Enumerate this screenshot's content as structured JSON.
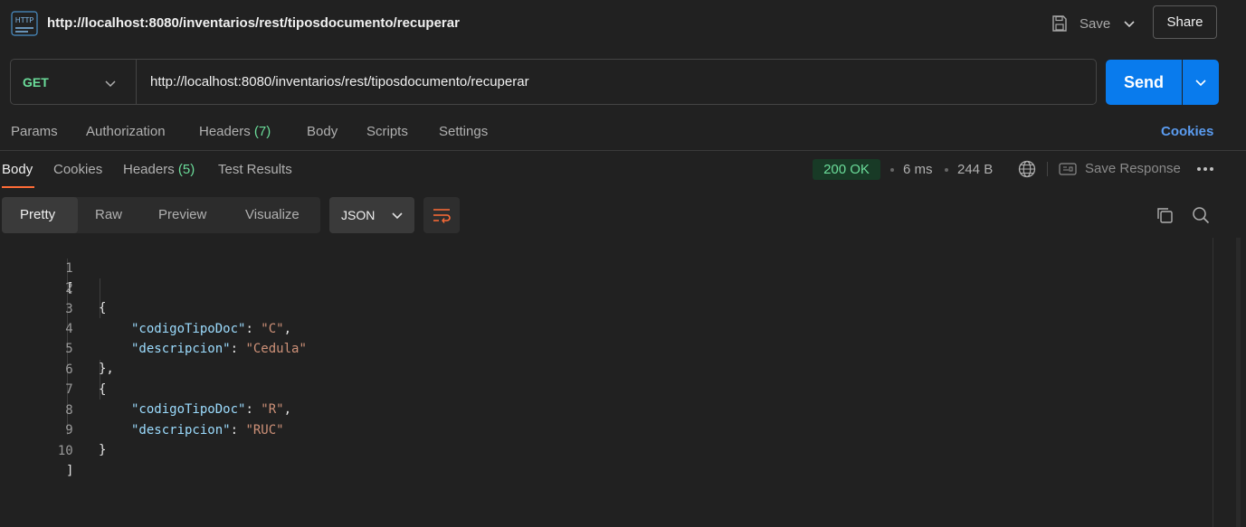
{
  "header": {
    "request_title": "http://localhost:8080/inventarios/rest/tiposdocumento/recuperar",
    "save_label": "Save",
    "share_label": "Share",
    "http_icon_text": "HTTP"
  },
  "url_bar": {
    "method": "GET",
    "url": "http://localhost:8080/inventarios/rest/tiposdocumento/recuperar",
    "send_label": "Send"
  },
  "request_tabs": {
    "params": "Params",
    "authorization": "Authorization",
    "headers": "Headers",
    "headers_count": "(7)",
    "body": "Body",
    "scripts": "Scripts",
    "settings": "Settings",
    "cookies": "Cookies"
  },
  "response_tabs": {
    "body": "Body",
    "cookies": "Cookies",
    "headers": "Headers",
    "headers_count": "(5)",
    "test_results": "Test Results"
  },
  "response_meta": {
    "status": "200 OK",
    "time": "6 ms",
    "size": "244 B",
    "save_response": "Save Response"
  },
  "view_modes": {
    "pretty": "Pretty",
    "raw": "Raw",
    "preview": "Preview",
    "visualize": "Visualize",
    "format": "JSON"
  },
  "code": {
    "line_numbers": [
      "1",
      "2",
      "3",
      "4",
      "5",
      "6",
      "7",
      "8",
      "9",
      "10"
    ],
    "open_bracket": "[",
    "close_bracket": "]",
    "open_brace": "{",
    "close_brace_comma": "},",
    "close_brace": "}",
    "items": [
      {
        "key1": "\"codigoTipoDoc\"",
        "val1": "\"C\"",
        "key2": "\"descripcion\"",
        "val2": "\"Cedula\""
      },
      {
        "key1": "\"codigoTipoDoc\"",
        "val1": "\"R\"",
        "key2": "\"descripcion\"",
        "val2": "\"RUC\""
      }
    ],
    "colon": ": ",
    "comma": ","
  },
  "colors": {
    "accent_orange": "#ff6c37",
    "send_blue": "#097bed",
    "status_green": "#6bdd9a",
    "json_key": "#9cdcfe",
    "json_string": "#ce9178"
  },
  "icons": [
    "http-icon",
    "save-icon",
    "chevron-down-icon",
    "globe-icon",
    "save-response-icon",
    "more-icon",
    "wrap-icon",
    "copy-icon",
    "search-icon"
  ]
}
